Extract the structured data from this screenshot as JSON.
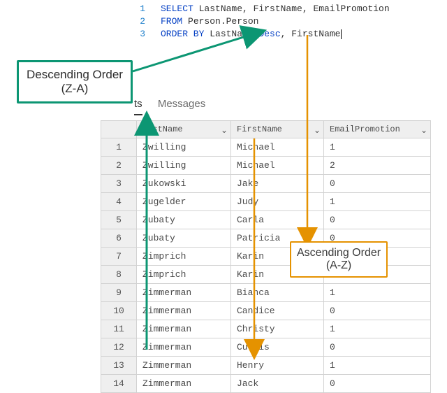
{
  "code": {
    "lines": [
      {
        "num": "1",
        "kw1": "SELECT",
        "rest": " LastName, FirstName, EmailPromotion"
      },
      {
        "num": "2",
        "kw1": "FROM",
        "rest": " Person.Person"
      },
      {
        "num": "3",
        "kw1": "ORDER BY",
        "rest": " LastName ",
        "kw2": "Desc",
        "rest2": ", FirstName"
      }
    ]
  },
  "callout_desc": {
    "l1": "Descending Order",
    "l2": "(Z-A)"
  },
  "callout_asc": {
    "l1": "Ascending Order",
    "l2": "(A-Z)"
  },
  "tabs": {
    "results_suffix": "ts",
    "messages": "Messages"
  },
  "grid": {
    "headers": {
      "c1": "LastName",
      "c2": "FirstName",
      "c3": "EmailPromotion"
    },
    "rows": [
      {
        "n": "1",
        "ln": "Zwilling",
        "fn": "Michael",
        "ep": "1"
      },
      {
        "n": "2",
        "ln": "Zwilling",
        "fn": "Michael",
        "ep": "2"
      },
      {
        "n": "3",
        "ln": "Zukowski",
        "fn": "Jake",
        "ep": "0"
      },
      {
        "n": "4",
        "ln": "Zugelder",
        "fn": "Judy",
        "ep": "1"
      },
      {
        "n": "5",
        "ln": "Zubaty",
        "fn": "Carla",
        "ep": "0"
      },
      {
        "n": "6",
        "ln": "Zubaty",
        "fn": "Patricia",
        "ep": "0"
      },
      {
        "n": "7",
        "ln": "Zimprich",
        "fn": "Karin",
        "ep": ""
      },
      {
        "n": "8",
        "ln": "Zimprich",
        "fn": "Karin",
        "ep": ""
      },
      {
        "n": "9",
        "ln": "Zimmerman",
        "fn": "Bianca",
        "ep": "1"
      },
      {
        "n": "10",
        "ln": "Zimmerman",
        "fn": "Candice",
        "ep": "0"
      },
      {
        "n": "11",
        "ln": "Zimmerman",
        "fn": "Christy",
        "ep": "1"
      },
      {
        "n": "12",
        "ln": "Zimmerman",
        "fn": "Curtis",
        "ep": "0"
      },
      {
        "n": "13",
        "ln": "Zimmerman",
        "fn": "Henry",
        "ep": "1"
      },
      {
        "n": "14",
        "ln": "Zimmerman",
        "fn": "Jack",
        "ep": "0"
      }
    ]
  },
  "chevron": "⌄"
}
